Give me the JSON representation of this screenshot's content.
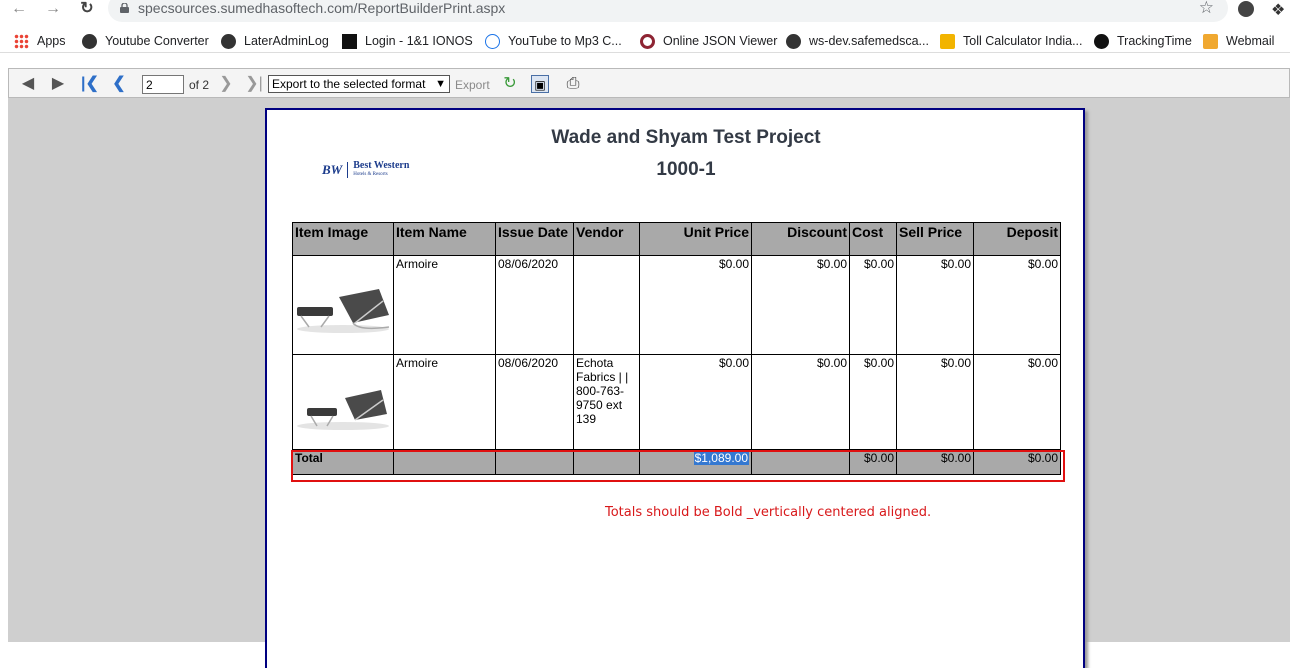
{
  "browser": {
    "url": "specsources.sumedhasoftech.com/ReportBuilderPrint.aspx"
  },
  "bookmarks": [
    {
      "label": "Apps",
      "icon": "apps-grid-icon"
    },
    {
      "label": "Youtube Converter",
      "icon": "globe-icon"
    },
    {
      "label": "LaterAdminLog",
      "icon": "globe-icon"
    },
    {
      "label": "Login - 1&1 IONOS",
      "icon": "ionos-icon"
    },
    {
      "label": "YouTube to Mp3 C...",
      "icon": "download-cloud-icon"
    },
    {
      "label": "Online JSON Viewer",
      "icon": "json-viewer-icon"
    },
    {
      "label": "ws-dev.safemedsca...",
      "icon": "globe-icon"
    },
    {
      "label": "Toll Calculator India...",
      "icon": "toll-icon"
    },
    {
      "label": "TrackingTime",
      "icon": "trackingtime-icon"
    },
    {
      "label": "Webmail",
      "icon": "mail-icon"
    }
  ],
  "toolbar": {
    "page_value": "2",
    "of_pages": "of 2",
    "export_format": "Export to the selected format",
    "export_label": "Export"
  },
  "report": {
    "title": "Wade and Shyam Test Project",
    "subtitle": "1000-1",
    "logo_mark": "BW",
    "logo_name": "Best Western",
    "logo_sub": "Hotels & Resorts",
    "columns": [
      "Item Image",
      "Item Name",
      "Issue Date",
      "Vendor",
      "Unit Price",
      "Discount",
      "Cost",
      "Sell Price",
      "Deposit"
    ],
    "rows": [
      {
        "name": "Armoire",
        "issue_date": "08/06/2020",
        "vendor": "",
        "unit_price": "$0.00",
        "discount": "$0.00",
        "cost": "$0.00",
        "sell_price": "$0.00",
        "deposit": "$0.00"
      },
      {
        "name": "Armoire",
        "issue_date": "08/06/2020",
        "vendor": "Echota Fabrics | | 800-763-9750 ext 139",
        "unit_price": "$0.00",
        "discount": "$0.00",
        "cost": "$0.00",
        "sell_price": "$0.00",
        "deposit": "$0.00"
      }
    ],
    "total": {
      "label": "Total",
      "unit_price": "$1,089.00",
      "cost": "$0.00",
      "sell_price": "$0.00",
      "deposit": "$0.00"
    }
  },
  "annotation": "Totals should be Bold _vertically centered aligned."
}
